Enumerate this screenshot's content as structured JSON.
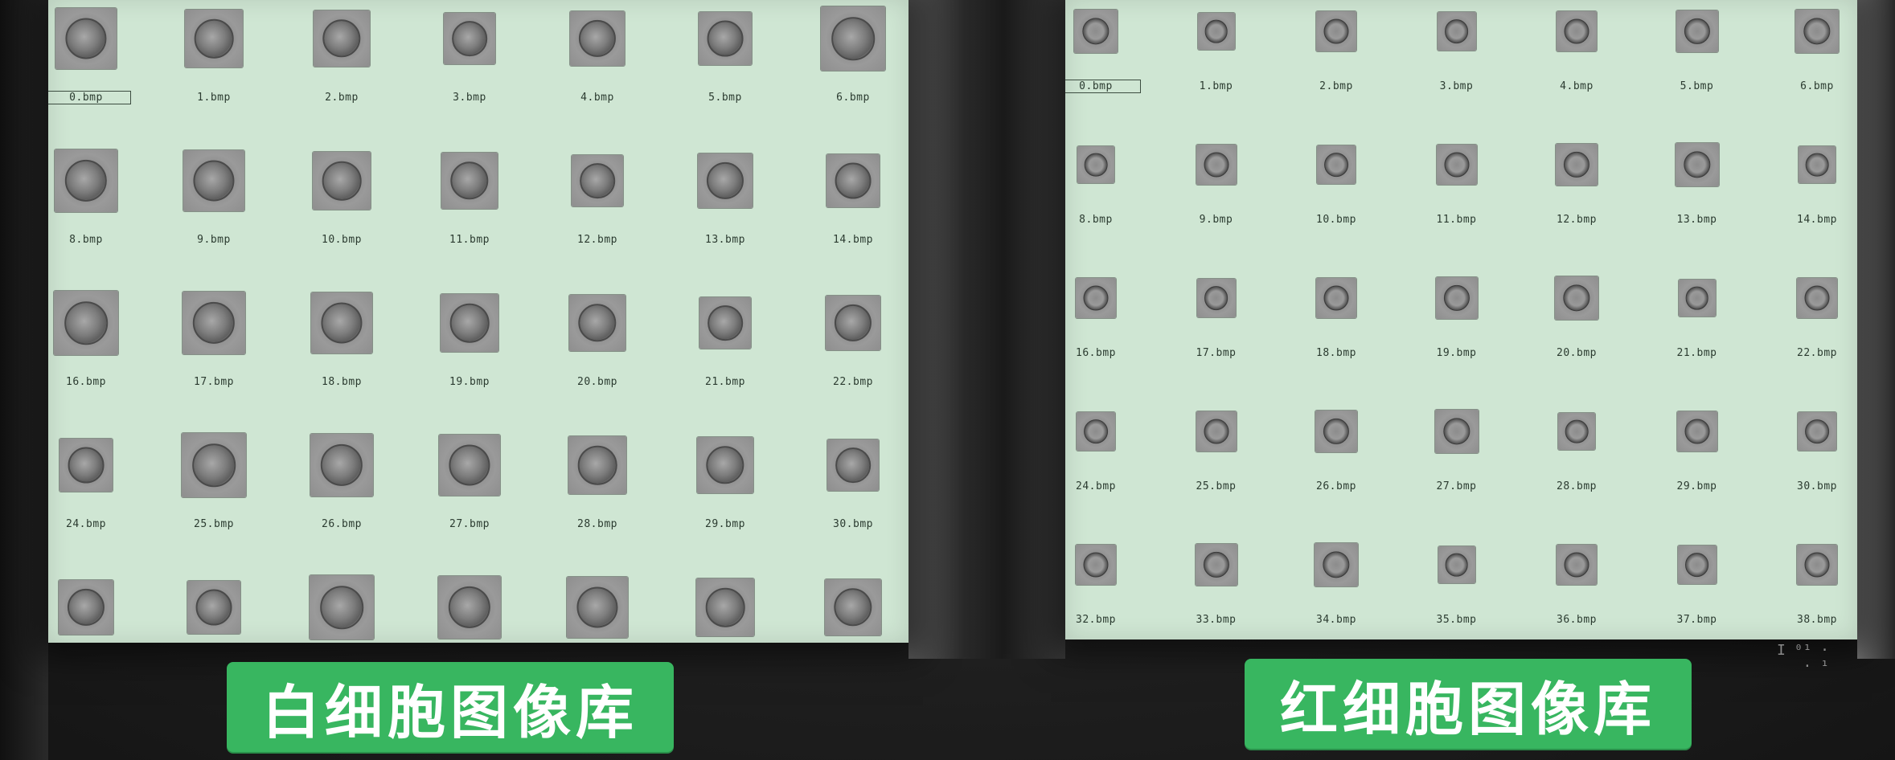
{
  "wbc_library": {
    "label": "白细胞图像库",
    "columns": 7,
    "files": [
      "0.bmp",
      "1.bmp",
      "2.bmp",
      "3.bmp",
      "4.bmp",
      "5.bmp",
      "6.bmp",
      "8.bmp",
      "9.bmp",
      "10.bmp",
      "11.bmp",
      "12.bmp",
      "13.bmp",
      "14.bmp",
      "16.bmp",
      "17.bmp",
      "18.bmp",
      "19.bmp",
      "20.bmp",
      "21.bmp",
      "22.bmp",
      "24.bmp",
      "25.bmp",
      "26.bmp",
      "27.bmp",
      "28.bmp",
      "29.bmp",
      "30.bmp",
      "",
      "",
      "",
      "",
      "",
      "",
      ""
    ],
    "selected": "0.bmp"
  },
  "rbc_library": {
    "label": "红细胞图像库",
    "columns": 7,
    "files": [
      "0.bmp",
      "1.bmp",
      "2.bmp",
      "3.bmp",
      "4.bmp",
      "5.bmp",
      "6.bmp",
      "8.bmp",
      "9.bmp",
      "10.bmp",
      "11.bmp",
      "12.bmp",
      "13.bmp",
      "14.bmp",
      "16.bmp",
      "17.bmp",
      "18.bmp",
      "19.bmp",
      "20.bmp",
      "21.bmp",
      "22.bmp",
      "24.bmp",
      "25.bmp",
      "26.bmp",
      "27.bmp",
      "28.bmp",
      "29.bmp",
      "30.bmp",
      "32.bmp",
      "33.bmp",
      "34.bmp",
      "35.bmp",
      "36.bmp",
      "37.bmp",
      "38.bmp"
    ],
    "selected": "0.bmp"
  },
  "colors": {
    "panel_bg": "#cfe6d3",
    "badge_green": "#38b660",
    "badge_text": "#ffffff"
  }
}
